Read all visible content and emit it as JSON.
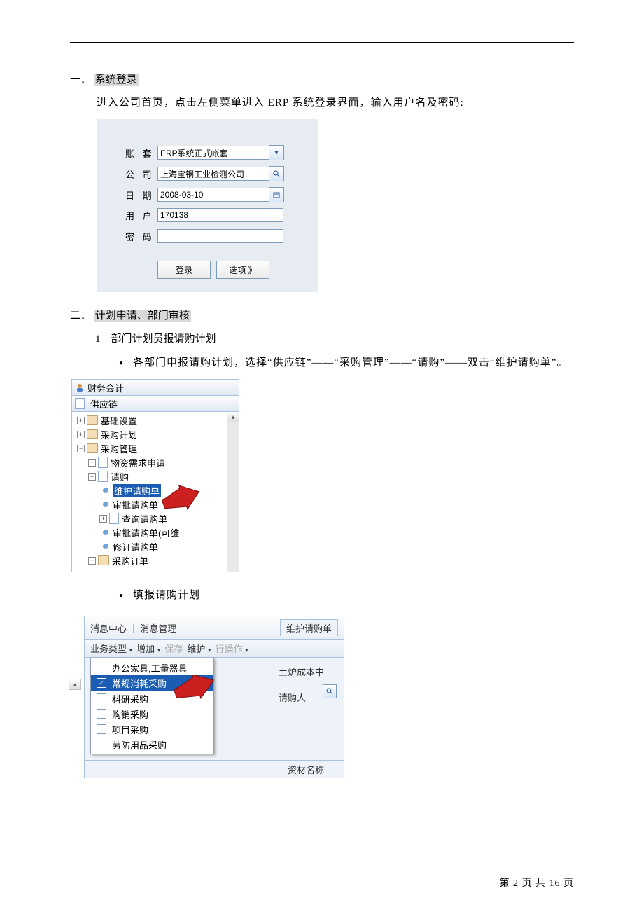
{
  "sections": {
    "s1_num": "一．",
    "s1_title": "系统登录",
    "s1_para": "进入公司首页，点击左侧菜单进入 ERP 系统登录界面，输入用户名及密码:",
    "s2_num": "二．",
    "s2_title": "计划申请、部门审核",
    "s2_sub_num": "1",
    "s2_sub_title": "部门计划员报请购计划",
    "s2_b1": "各部门申报请购计划，选择“供应链”——“采购管理”——“请购”——双击“维护请购单”。",
    "s2_b2": "填报请购计划"
  },
  "login": {
    "labels": {
      "account": "账 套",
      "company": "公 司",
      "date": "日 期",
      "user": "用 户",
      "password": "密 码"
    },
    "values": {
      "account": "ERP系统正式帐套",
      "company": "上海宝钢工业检测公司",
      "date": "2008-03-10",
      "user": "170138",
      "password": ""
    },
    "buttons": {
      "login": "登录",
      "options": "选项 》"
    }
  },
  "tree": {
    "top1": "财务会计",
    "top2": "供应链",
    "n1": "基础设置",
    "n2": "采购计划",
    "n3": "采购管理",
    "n3a": "物资需求申请",
    "n3b": "请购",
    "n3b1": "维护请购单",
    "n3b2": "审批请购单",
    "n3b3": "查询请购单",
    "n3b4": "审批请购单(可维",
    "n3b5": "修订请购单",
    "n4": "采购订单"
  },
  "dropdown": {
    "tabs": {
      "msg_center": "消息中心",
      "msg_mgmt": "消息管理",
      "active": "维护请购单"
    },
    "toolbar": {
      "biztype": "业务类型",
      "add": "增加",
      "save": "保存",
      "maintain": "维护",
      "rowop": "行操作"
    },
    "right": {
      "r1": "土炉成本中",
      "r2": "请购人",
      "r3": "资材名称"
    },
    "items": [
      "办公家具,工量器具",
      "常规消耗采购",
      "科研采购",
      "购销采购",
      "项目采购",
      "劳防用品采购"
    ],
    "selected_index": 1
  },
  "footer": {
    "text": "第 2 页 共 16 页"
  }
}
